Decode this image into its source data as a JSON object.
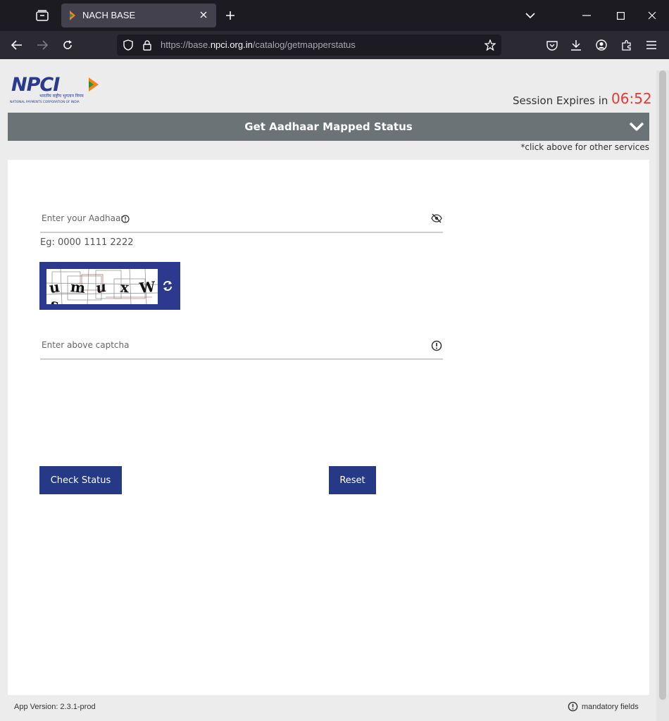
{
  "browser": {
    "tab_title": "NACH BASE",
    "url_prefix": "https://base.",
    "url_host": "npci.org.in",
    "url_path": "/catalog/getmapperstatus"
  },
  "page": {
    "logo_text": "NPCI",
    "logo_hindi": "भारतीय राष्ट्रीय भुगतान निगम",
    "logo_subtext": "NATIONAL PAYMENTS CORPORATION OF INDIA",
    "session_label": "Session Expires in",
    "session_time": "06:52",
    "service_title": "Get Aadhaar Mapped Status",
    "service_hint": "*click above for other services",
    "aadhaar_placeholder": "Enter your Aadhaar",
    "aadhaar_example": "Eg: 0000 1111 2222",
    "captcha_chars": [
      "u",
      "m",
      "u",
      "x",
      "W",
      "s"
    ],
    "captcha_placeholder": "Enter above captcha",
    "check_status_label": "Check Status",
    "reset_label": "Reset",
    "app_version": "App Version: 2.3.1-prod",
    "mandatory_label": "mandatory fields"
  },
  "colors": {
    "brand_blue": "#263987",
    "header_grey": "#6b7377",
    "timer_red": "#e53935"
  }
}
